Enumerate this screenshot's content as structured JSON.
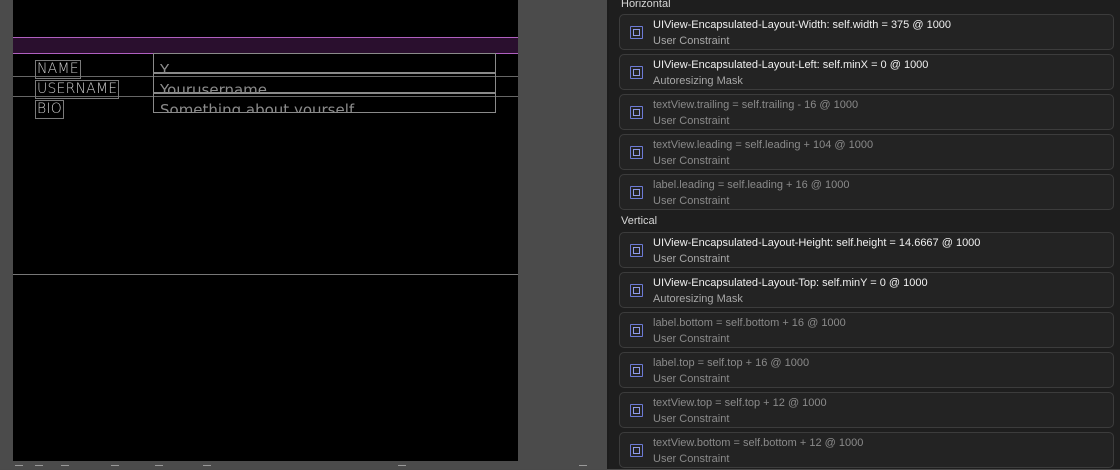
{
  "form": {
    "fields": [
      {
        "label": "NAME",
        "value": "Y"
      },
      {
        "label": "USERNAME",
        "value": "Yourusername"
      },
      {
        "label": "BIO",
        "value": "Something about yourself"
      }
    ]
  },
  "inspector": {
    "horizontal_header": "Horizontal",
    "vertical_header": "Vertical",
    "horizontal": [
      {
        "title": "UIView-Encapsulated-Layout-Width: self.width = 375 @ 1000",
        "subtitle": "User Constraint",
        "icon": "width-constraint-icon",
        "active": true
      },
      {
        "title": "UIView-Encapsulated-Layout-Left: self.minX = 0 @ 1000",
        "subtitle": "Autoresizing Mask",
        "icon": "autoresizing-mask-icon",
        "active": true
      },
      {
        "title": "textView.trailing = self.trailing - 16 @ 1000",
        "subtitle": "User Constraint",
        "icon": "trailing-constraint-icon",
        "active": false
      },
      {
        "title": "textView.leading = self.leading + 104 @ 1000",
        "subtitle": "User Constraint",
        "icon": "leading-constraint-icon",
        "active": false
      },
      {
        "title": "label.leading = self.leading + 16 @ 1000",
        "subtitle": "User Constraint",
        "icon": "leading-constraint-icon",
        "active": false
      }
    ],
    "vertical": [
      {
        "title": "UIView-Encapsulated-Layout-Height: self.height = 14.6667 @ 1000",
        "subtitle": "User Constraint",
        "icon": "height-constraint-icon",
        "active": true
      },
      {
        "title": "UIView-Encapsulated-Layout-Top: self.minY = 0 @ 1000",
        "subtitle": "Autoresizing Mask",
        "icon": "autoresizing-mask-icon",
        "active": true
      },
      {
        "title": "label.bottom = self.bottom + 16 @ 1000",
        "subtitle": "User Constraint",
        "icon": "bottom-constraint-icon",
        "active": false
      },
      {
        "title": "label.top = self.top + 16 @ 1000",
        "subtitle": "User Constraint",
        "icon": "top-constraint-icon",
        "active": false
      },
      {
        "title": "textView.top = self.top + 12 @ 1000",
        "subtitle": "User Constraint",
        "icon": "top-constraint-icon",
        "active": false
      },
      {
        "title": "textView.bottom = self.bottom + 12 @ 1000",
        "subtitle": "User Constraint",
        "icon": "bottom-constraint-icon",
        "active": false
      }
    ]
  },
  "colors": {
    "accent_icon": "#6d7bd6",
    "selection_outline": "#b060c0",
    "canvas_background": "#000000",
    "inspector_background": "#1e1e1e"
  }
}
